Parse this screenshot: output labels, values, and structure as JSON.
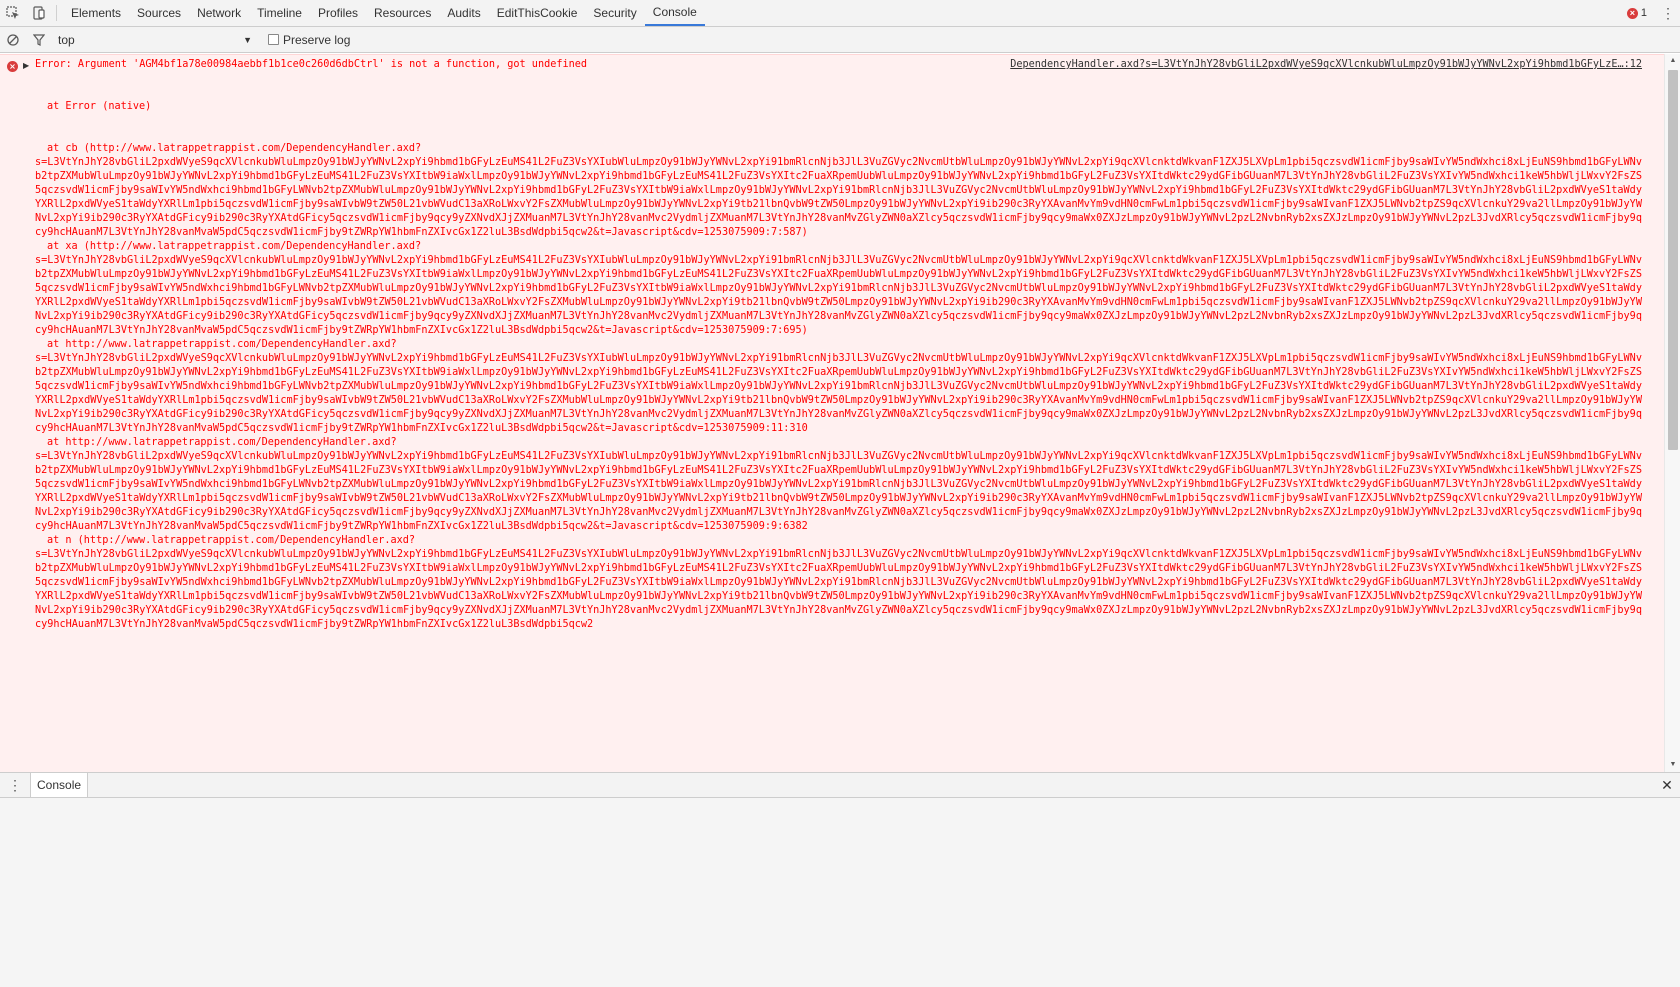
{
  "tabbar": {
    "tabs": [
      {
        "label": "Elements"
      },
      {
        "label": "Sources"
      },
      {
        "label": "Network"
      },
      {
        "label": "Timeline"
      },
      {
        "label": "Profiles"
      },
      {
        "label": "Resources"
      },
      {
        "label": "Audits"
      },
      {
        "label": "EditThisCookie"
      },
      {
        "label": "Security"
      },
      {
        "label": "Console"
      }
    ],
    "active_tab": "Console",
    "error_count": "1",
    "accent_color": "#3879d9",
    "icons": [
      "inspect-element-icon",
      "device-mode-icon",
      "error-icon",
      "more-options-icon"
    ]
  },
  "filterbar": {
    "context_value": "top",
    "preserve_log_label": "Preserve log",
    "icons": [
      "clear-console-icon",
      "filter-icon",
      "dropdown-arrow-icon"
    ]
  },
  "console": {
    "error_color": "#ff0000",
    "error_bg": "#fff0f0",
    "message": {
      "text": "Error: Argument 'AGM4bf1a78e00984aebbf1b1ce0c260d6dbCtrl' is not a function, got undefined",
      "source_link": "DependencyHandler.axd?s=L3VtYnJhY28vbGliL2pxdWVyeS9qcXVlcnkubWluLmpzOy91bWJyYWNvL2xpYi9hbmd1bGFyLzE…:12",
      "first_line": "at Error (native)",
      "frames": [
        {
          "at": "at cb (http://www.latrappetrappist.com/DependencyHandler.axd?",
          "query": "s=L3VtYnJhY28vbGliL2pxdWVyeS9qcXVlcnkubWluLmpzOy91bWJyYWNvL2xpYi9hbmd1bGFyLzEuMS41L2FuZ3VsYXIubWluLmpzOy91bWJyYWNvL2xpYi91bmRlcnNjb3JlL3VuZGVyc2NvcmUtbWluLmpzOy91bWJyYWNvL2xpYi9qcXVlcnktdWkvanF1ZXJ5LXVpLm1pbi5qczsvdW1icmFjby9saWIvYW5ndWxhci8xLjEuNS9hbmd1bGFyLWNvb2tpZXMubWluLmpzOy91bWJyYWNvL2xpYi9hbmd1bGFyLzEuMS41L2FuZ3VsYXItbW9iaWxlLmpzOy91bWJyYWNvL2xpYi9hbmd1bGFyLzEuMS41L2FuZ3VsYXItc2FuaXRpemUubWluLmpzOy91bWJyYWNvL2xpYi9hbmd1bGFyL2FuZ3VsYXItdWktc29ydGFibGUuanM7L3VtYnJhY28vbGliL2FuZ3VsYXIvYW5ndWxhci1keW5hbWljLWxvY2FsZS5qczsvdW1icmFjby9saWIvYW5ndWxhci9hbmd1bGFyLWNvb2tpZXMubWluLmpzOy91bWJyYWNvL2xpYi9hbmd1bGFyL2FuZ3VsYXItbW9iaWxlLmpzOy91bWJyYWNvL2xpYi91bmRlcnNjb3JlL3VuZGVyc2NvcmUtbWluLmpzOy91bWJyYWNvL2xpYi9hbmd1bGFyL2FuZ3VsYXItdWktc29ydGFibGUuanM7L3VtYnJhY28vbGliL2pxdWVyeS1taWdyYXRlL2pxdWVyeS1taWdyYXRlLm1pbi5qczsvdW1icmFjby9saWIvbW9tZW50L21vbWVudC13aXRoLWxvY2FsZXMubWluLmpzOy91bWJyYWNvL2xpYi9tb21lbnQvbW9tZW50LmpzOy91bWJyYWNvL2xpYi9ib290c3RyYXAvanMvYm9vdHN0cmFwLm1pbi5qczsvdW1icmFjby9saWIvanF1ZXJ5LWNvb2tpZS9qcXVlcnkuY29va2llLmpzOy91bWJyYWNvL2xpYi9ib290c3RyYXAtdGFicy9ib290c3RyYXAtdGFicy5qczsvdW1icmFjby9qcy9yZXNvdXJjZXMuanM7L3VtYnJhY28vanMvc2VydmljZXMuanM7L3VtYnJhY28vanMvZGlyZWN0aXZlcy5qczsvdW1icmFjby9qcy9maWx0ZXJzLmpzOy91bWJyYWNvL2pzL2NvbnRyb2xsZXJzLmpzOy91bWJyYWNvL2pzL3JvdXRlcy5qczsvdW1icmFjby9qcy9hcHAuanM7L3VtYnJhY28vanMvaW5pdC5qczsvdW1icmFjby9tZWRpYW1hbmFnZXIvcGx1Z2luL3BsdWdpbi5qcw2&t=Javascript&cdv=1253075909:7:587)"
        },
        {
          "at": "at xa (http://www.latrappetrappist.com/DependencyHandler.axd?",
          "query": "s=L3VtYnJhY28vbGliL2pxdWVyeS9qcXVlcnkubWluLmpzOy91bWJyYWNvL2xpYi9hbmd1bGFyLzEuMS41L2FuZ3VsYXIubWluLmpzOy91bWJyYWNvL2xpYi91bmRlcnNjb3JlL3VuZGVyc2NvcmUtbWluLmpzOy91bWJyYWNvL2xpYi9qcXVlcnktdWkvanF1ZXJ5LXVpLm1pbi5qczsvdW1icmFjby9saWIvYW5ndWxhci8xLjEuNS9hbmd1bGFyLWNvb2tpZXMubWluLmpzOy91bWJyYWNvL2xpYi9hbmd1bGFyLzEuMS41L2FuZ3VsYXItbW9iaWxlLmpzOy91bWJyYWNvL2xpYi9hbmd1bGFyLzEuMS41L2FuZ3VsYXItc2FuaXRpemUubWluLmpzOy91bWJyYWNvL2xpYi9hbmd1bGFyL2FuZ3VsYXItdWktc29ydGFibGUuanM7L3VtYnJhY28vbGliL2FuZ3VsYXIvYW5ndWxhci1keW5hbWljLWxvY2FsZS5qczsvdW1icmFjby9saWIvYW5ndWxhci9hbmd1bGFyLWNvb2tpZXMubWluLmpzOy91bWJyYWNvL2xpYi9hbmd1bGFyL2FuZ3VsYXItbW9iaWxlLmpzOy91bWJyYWNvL2xpYi91bmRlcnNjb3JlL3VuZGVyc2NvcmUtbWluLmpzOy91bWJyYWNvL2xpYi9hbmd1bGFyL2FuZ3VsYXItdWktc29ydGFibGUuanM7L3VtYnJhY28vbGliL2pxdWVyeS1taWdyYXRlL2pxdWVyeS1taWdyYXRlLm1pbi5qczsvdW1icmFjby9saWIvbW9tZW50L21vbWVudC13aXRoLWxvY2FsZXMubWluLmpzOy91bWJyYWNvL2xpYi9tb21lbnQvbW9tZW50LmpzOy91bWJyYWNvL2xpYi9ib290c3RyYXAvanMvYm9vdHN0cmFwLm1pbi5qczsvdW1icmFjby9saWIvanF1ZXJ5LWNvb2tpZS9qcXVlcnkuY29va2llLmpzOy91bWJyYWNvL2xpYi9ib290c3RyYXAtdGFicy9ib290c3RyYXAtdGFicy5qczsvdW1icmFjby9qcy9yZXNvdXJjZXMuanM7L3VtYnJhY28vanMvc2VydmljZXMuanM7L3VtYnJhY28vanMvZGlyZWN0aXZlcy5qczsvdW1icmFjby9qcy9maWx0ZXJzLmpzOy91bWJyYWNvL2pzL2NvbnRyb2xsZXJzLmpzOy91bWJyYWNvL2pzL3JvdXRlcy5qczsvdW1icmFjby9qcy9hcHAuanM7L3VtYnJhY28vanMvaW5pdC5qczsvdW1icmFjby9tZWRpYW1hbmFnZXIvcGx1Z2luL3BsdWdpbi5qcw2&t=Javascript&cdv=1253075909:7:695)"
        },
        {
          "at": "at http://www.latrappetrappist.com/DependencyHandler.axd?",
          "query": "s=L3VtYnJhY28vbGliL2pxdWVyeS9qcXVlcnkubWluLmpzOy91bWJyYWNvL2xpYi9hbmd1bGFyLzEuMS41L2FuZ3VsYXIubWluLmpzOy91bWJyYWNvL2xpYi91bmRlcnNjb3JlL3VuZGVyc2NvcmUtbWluLmpzOy91bWJyYWNvL2xpYi9qcXVlcnktdWkvanF1ZXJ5LXVpLm1pbi5qczsvdW1icmFjby9saWIvYW5ndWxhci8xLjEuNS9hbmd1bGFyLWNvb2tpZXMubWluLmpzOy91bWJyYWNvL2xpYi9hbmd1bGFyLzEuMS41L2FuZ3VsYXItbW9iaWxlLmpzOy91bWJyYWNvL2xpYi9hbmd1bGFyLzEuMS41L2FuZ3VsYXItc2FuaXRpemUubWluLmpzOy91bWJyYWNvL2xpYi9hbmd1bGFyL2FuZ3VsYXItdWktc29ydGFibGUuanM7L3VtYnJhY28vbGliL2FuZ3VsYXIvYW5ndWxhci1keW5hbWljLWxvY2FsZS5qczsvdW1icmFjby9saWIvYW5ndWxhci9hbmd1bGFyLWNvb2tpZXMubWluLmpzOy91bWJyYWNvL2xpYi9hbmd1bGFyL2FuZ3VsYXItbW9iaWxlLmpzOy91bWJyYWNvL2xpYi91bmRlcnNjb3JlL3VuZGVyc2NvcmUtbWluLmpzOy91bWJyYWNvL2xpYi9hbmd1bGFyL2FuZ3VsYXItdWktc29ydGFibGUuanM7L3VtYnJhY28vbGliL2pxdWVyeS1taWdyYXRlL2pxdWVyeS1taWdyYXRlLm1pbi5qczsvdW1icmFjby9saWIvbW9tZW50L21vbWVudC13aXRoLWxvY2FsZXMubWluLmpzOy91bWJyYWNvL2xpYi9tb21lbnQvbW9tZW50LmpzOy91bWJyYWNvL2xpYi9ib290c3RyYXAvanMvYm9vdHN0cmFwLm1pbi5qczsvdW1icmFjby9saWIvanF1ZXJ5LWNvb2tpZS9qcXVlcnkuY29va2llLmpzOy91bWJyYWNvL2xpYi9ib290c3RyYXAtdGFicy9ib290c3RyYXAtdGFicy5qczsvdW1icmFjby9qcy9yZXNvdXJjZXMuanM7L3VtYnJhY28vanMvc2VydmljZXMuanM7L3VtYnJhY28vanMvZGlyZWN0aXZlcy5qczsvdW1icmFjby9qcy9maWx0ZXJzLmpzOy91bWJyYWNvL2pzL2NvbnRyb2xsZXJzLmpzOy91bWJyYWNvL2pzL3JvdXRlcy5qczsvdW1icmFjby9qcy9hcHAuanM7L3VtYnJhY28vanMvaW5pdC5qczsvdW1icmFjby9tZWRpYW1hbmFnZXIvcGx1Z2luL3BsdWdpbi5qcw2&t=Javascript&cdv=1253075909:11:310"
        },
        {
          "at": "at http://www.latrappetrappist.com/DependencyHandler.axd?",
          "query": "s=L3VtYnJhY28vbGliL2pxdWVyeS9qcXVlcnkubWluLmpzOy91bWJyYWNvL2xpYi9hbmd1bGFyLzEuMS41L2FuZ3VsYXIubWluLmpzOy91bWJyYWNvL2xpYi91bmRlcnNjb3JlL3VuZGVyc2NvcmUtbWluLmpzOy91bWJyYWNvL2xpYi9qcXVlcnktdWkvanF1ZXJ5LXVpLm1pbi5qczsvdW1icmFjby9saWIvYW5ndWxhci8xLjEuNS9hbmd1bGFyLWNvb2tpZXMubWluLmpzOy91bWJyYWNvL2xpYi9hbmd1bGFyLzEuMS41L2FuZ3VsYXItbW9iaWxlLmpzOy91bWJyYWNvL2xpYi9hbmd1bGFyLzEuMS41L2FuZ3VsYXItc2FuaXRpemUubWluLmpzOy91bWJyYWNvL2xpYi9hbmd1bGFyL2FuZ3VsYXItdWktc29ydGFibGUuanM7L3VtYnJhY28vbGliL2FuZ3VsYXIvYW5ndWxhci1keW5hbWljLWxvY2FsZS5qczsvdW1icmFjby9saWIvYW5ndWxhci9hbmd1bGFyLWNvb2tpZXMubWluLmpzOy91bWJyYWNvL2xpYi9hbmd1bGFyL2FuZ3VsYXItbW9iaWxlLmpzOy91bWJyYWNvL2xpYi91bmRlcnNjb3JlL3VuZGVyc2NvcmUtbWluLmpzOy91bWJyYWNvL2xpYi9hbmd1bGFyL2FuZ3VsYXItdWktc29ydGFibGUuanM7L3VtYnJhY28vbGliL2pxdWVyeS1taWdyYXRlL2pxdWVyeS1taWdyYXRlLm1pbi5qczsvdW1icmFjby9saWIvbW9tZW50L21vbWVudC13aXRoLWxvY2FsZXMubWluLmpzOy91bWJyYWNvL2xpYi9tb21lbnQvbW9tZW50LmpzOy91bWJyYWNvL2xpYi9ib290c3RyYXAvanMvYm9vdHN0cmFwLm1pbi5qczsvdW1icmFjby9saWIvanF1ZXJ5LWNvb2tpZS9qcXVlcnkuY29va2llLmpzOy91bWJyYWNvL2xpYi9ib290c3RyYXAtdGFicy9ib290c3RyYXAtdGFicy5qczsvdW1icmFjby9qcy9yZXNvdXJjZXMuanM7L3VtYnJhY28vanMvc2VydmljZXMuanM7L3VtYnJhY28vanMvZGlyZWN0aXZlcy5qczsvdW1icmFjby9qcy9maWx0ZXJzLmpzOy91bWJyYWNvL2pzL2NvbnRyb2xsZXJzLmpzOy91bWJyYWNvL2pzL3JvdXRlcy5qczsvdW1icmFjby9qcy9hcHAuanM7L3VtYnJhY28vanMvaW5pdC5qczsvdW1icmFjby9tZWRpYW1hbmFnZXIvcGx1Z2luL3BsdWdpbi5qcw2&t=Javascript&cdv=1253075909:9:6382"
        },
        {
          "at": "at n (http://www.latrappetrappist.com/DependencyHandler.axd?",
          "query": "s=L3VtYnJhY28vbGliL2pxdWVyeS9qcXVlcnkubWluLmpzOy91bWJyYWNvL2xpYi9hbmd1bGFyLzEuMS41L2FuZ3VsYXIubWluLmpzOy91bWJyYWNvL2xpYi91bmRlcnNjb3JlL3VuZGVyc2NvcmUtbWluLmpzOy91bWJyYWNvL2xpYi9qcXVlcnktdWkvanF1ZXJ5LXVpLm1pbi5qczsvdW1icmFjby9saWIvYW5ndWxhci8xLjEuNS9hbmd1bGFyLWNvb2tpZXMubWluLmpzOy91bWJyYWNvL2xpYi9hbmd1bGFyLzEuMS41L2FuZ3VsYXItbW9iaWxlLmpzOy91bWJyYWNvL2xpYi9hbmd1bGFyLzEuMS41L2FuZ3VsYXItc2FuaXRpemUubWluLmpzOy91bWJyYWNvL2xpYi9hbmd1bGFyL2FuZ3VsYXItdWktc29ydGFibGUuanM7L3VtYnJhY28vbGliL2FuZ3VsYXIvYW5ndWxhci1keW5hbWljLWxvY2FsZS5qczsvdW1icmFjby9saWIvYW5ndWxhci9hbmd1bGFyLWNvb2tpZXMubWluLmpzOy91bWJyYWNvL2xpYi9hbmd1bGFyL2FuZ3VsYXItbW9iaWxlLmpzOy91bWJyYWNvL2xpYi91bmRlcnNjb3JlL3VuZGVyc2NvcmUtbWluLmpzOy91bWJyYWNvL2xpYi9hbmd1bGFyL2FuZ3VsYXItdWktc29ydGFibGUuanM7L3VtYnJhY28vbGliL2pxdWVyeS1taWdyYXRlL2pxdWVyeS1taWdyYXRlLm1pbi5qczsvdW1icmFjby9saWIvbW9tZW50L21vbWVudC13aXRoLWxvY2FsZXMubWluLmpzOy91bWJyYWNvL2xpYi9tb21lbnQvbW9tZW50LmpzOy91bWJyYWNvL2xpYi9ib290c3RyYXAvanMvYm9vdHN0cmFwLm1pbi5qczsvdW1icmFjby9saWIvanF1ZXJ5LWNvb2tpZS9qcXVlcnkuY29va2llLmpzOy91bWJyYWNvL2xpYi9ib290c3RyYXAtdGFicy9ib290c3RyYXAtdGFicy5qczsvdW1icmFjby9qcy9yZXNvdXJjZXMuanM7L3VtYnJhY28vanMvc2VydmljZXMuanM7L3VtYnJhY28vanMvZGlyZWN0aXZlcy5qczsvdW1icmFjby9qcy9maWx0ZXJzLmpzOy91bWJyYWNvL2pzL2NvbnRyb2xsZXJzLmpzOy91bWJyYWNvL2pzL3JvdXRlcy5qczsvdW1icmFjby9qcy9hcHAuanM7L3VtYnJhY28vanMvaW5pdC5qczsvdW1icmFjby9tZWRpYW1hbmFnZXIvcGx1Z2luL3BsdWdpbi5qcw2"
        }
      ]
    }
  },
  "drawer": {
    "tab_label": "Console",
    "icons": [
      "drawer-menu-icon",
      "close-icon"
    ]
  }
}
